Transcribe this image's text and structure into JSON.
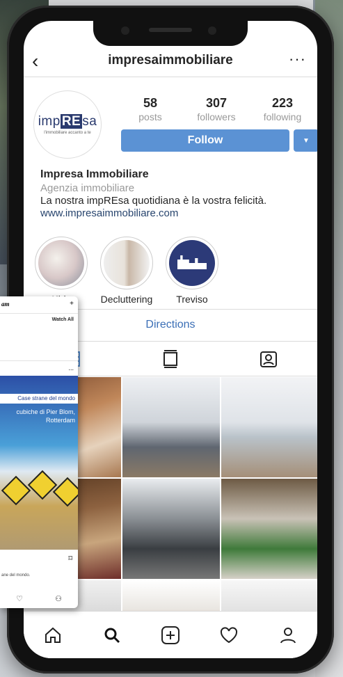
{
  "header": {
    "back_icon": "chevron-left-icon",
    "username": "impresaimmobiliare",
    "more_icon": "more-horizontal-icon"
  },
  "profile": {
    "logo_text_left": "imp",
    "logo_text_highlight": "RE",
    "logo_text_right": "sa",
    "logo_tagline": "l'immobiliare accanto a te",
    "stats": [
      {
        "value": "58",
        "label": "posts"
      },
      {
        "value": "307",
        "label": "followers"
      },
      {
        "value": "223",
        "label": "following"
      }
    ],
    "follow_label": "Follow",
    "dropdown_glyph": "▼",
    "name": "Impresa Immobiliare",
    "category": "Agenzia immobiliare",
    "bio": "La nostra impREsa quotidiana è la vostra felicità.",
    "website": "www.impresaimmobiliare.com"
  },
  "highlights": [
    {
      "label": "Kids"
    },
    {
      "label": "Decluttering"
    },
    {
      "label": "Treviso"
    }
  ],
  "directions_label": "Directions",
  "tabs": [
    {
      "name": "grid-icon",
      "active": true
    },
    {
      "name": "igtv-icon",
      "active": false
    },
    {
      "name": "tagged-icon",
      "active": false
    }
  ],
  "bottom_nav": [
    {
      "name": "home-icon"
    },
    {
      "name": "search-icon"
    },
    {
      "name": "new-post-icon"
    },
    {
      "name": "heart-icon"
    },
    {
      "name": "profile-icon"
    }
  ],
  "overlay_card": {
    "brand": "am",
    "add_glyph": "+",
    "watch_all": "Watch All",
    "more": "...",
    "banner": "Case strane del mondo",
    "subtitle_line1": "cubiche di Pier Blom,",
    "subtitle_line2": "Rotterdam",
    "caption": "ane del mondo."
  },
  "colors": {
    "accent": "#5b92d4",
    "link": "#28456e",
    "directions": "#3b6fb6",
    "brand_navy": "#2a3a6e"
  }
}
